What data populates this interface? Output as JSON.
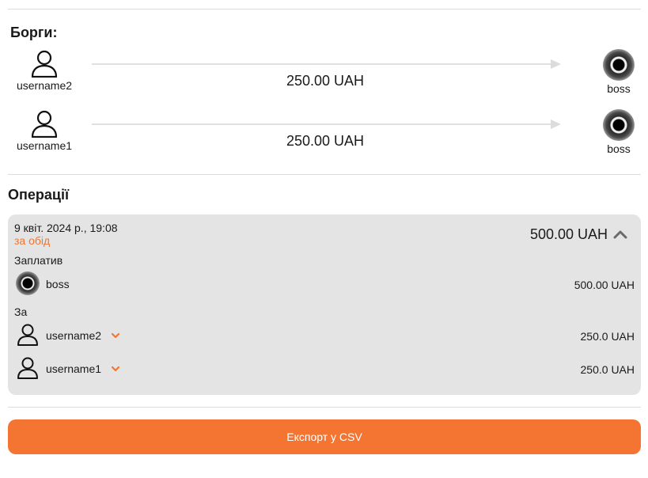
{
  "debts": {
    "title": "Борги:",
    "items": [
      {
        "from": "username2",
        "to": "boss",
        "amount": "250.00 UAH"
      },
      {
        "from": "username1",
        "to": "boss",
        "amount": "250.00 UAH"
      }
    ]
  },
  "operations": {
    "title": "Операції",
    "items": [
      {
        "date": "9 квіт. 2024 р., 19:08",
        "description": "за обід",
        "total": "500.00 UAH",
        "paid_label": "Заплатив",
        "payer": {
          "name": "boss",
          "amount": "500.00 UAH"
        },
        "for_label": "За",
        "participants": [
          {
            "name": "username2",
            "amount": "250.0 UAH"
          },
          {
            "name": "username1",
            "amount": "250.0 UAH"
          }
        ]
      }
    ]
  },
  "export_button": {
    "label": "Експорт у CSV"
  },
  "colors": {
    "accent": "#f47532",
    "card_bg": "#e4e4e4",
    "divider": "#dcdcdc"
  },
  "icons": {
    "user": "user-outline-icon",
    "boss_avatar": "boss-avatar",
    "expand": "chevron-up-icon",
    "participant_toggle": "chevron-down-icon"
  }
}
